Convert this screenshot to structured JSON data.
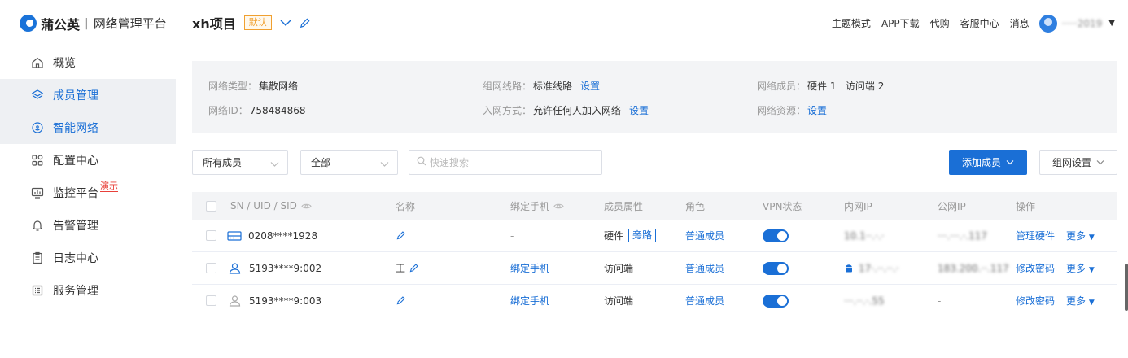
{
  "brand": {
    "name": "蒲公英",
    "subtitle": "网络管理平台"
  },
  "sidebar": {
    "items": [
      {
        "label": "概览",
        "icon": "home-icon"
      },
      {
        "label": "成员管理",
        "icon": "layers-icon",
        "active": true
      },
      {
        "label": "智能网络",
        "icon": "smart-network-icon",
        "active": true
      },
      {
        "label": "配置中心",
        "icon": "grid-icon"
      },
      {
        "label": "监控平台",
        "icon": "monitor-icon",
        "tag": "演示"
      },
      {
        "label": "告警管理",
        "icon": "bell-icon"
      },
      {
        "label": "日志中心",
        "icon": "log-icon"
      },
      {
        "label": "服务管理",
        "icon": "service-icon"
      }
    ]
  },
  "header": {
    "project_name": "xh项目",
    "default_badge": "默认",
    "links": [
      "主题模式",
      "APP下载",
      "代购",
      "客服中心",
      "消息"
    ],
    "username": "·····2019"
  },
  "network_info": {
    "type_label": "网络类型：",
    "type_value": "集散网络",
    "id_label": "网络ID：",
    "id_value": "758484868",
    "route_label": "组网线路：",
    "route_value": "标准线路",
    "route_link": "设置",
    "join_label": "入网方式：",
    "join_value": "允许任何人加入网络",
    "join_link": "设置",
    "members_label": "网络成员：",
    "members_value": "硬件 1   访问端 2",
    "resources_label": "网络资源：",
    "resources_link": "设置"
  },
  "filters": {
    "member_filter": "所有成员",
    "status_filter": "全部",
    "search_placeholder": "快速搜索",
    "add_member_button": "添加成员",
    "network_settings_button": "组网设置"
  },
  "table": {
    "headers": [
      "SN / UID / SID",
      "名称",
      "绑定手机",
      "成员属性",
      "角色",
      "VPN状态",
      "内网IP",
      "公网IP",
      "操作"
    ],
    "rows": [
      {
        "id": "0208****1928",
        "icon": "router-icon",
        "name": "",
        "phone": "-",
        "attribute": "硬件",
        "bypass_tag": "旁路",
        "role": "普通成员",
        "vpn": true,
        "lan_ip": "10.1··.·.·",
        "wan_ip": "···.···.·.117",
        "action": "管理硬件",
        "more": "更多"
      },
      {
        "id": "5193****9:002",
        "icon": "user-icon",
        "name": "王",
        "phone": "绑定手机",
        "attribute": "访问端",
        "bypass_tag": "",
        "role": "普通成员",
        "vpn": true,
        "lan_ip": "17·.··.··.·",
        "wan_ip": "183.200.··.117",
        "action": "修改密码",
        "more": "更多"
      },
      {
        "id": "5193****9:003",
        "icon": "user-outline-icon",
        "name": "",
        "phone": "绑定手机",
        "attribute": "访问端",
        "bypass_tag": "",
        "role": "普通成员",
        "vpn": true,
        "lan_ip": "···.··.·.55",
        "wan_ip": "-",
        "action": "修改密码",
        "more": "更多"
      }
    ]
  },
  "colors": {
    "accent": "#1a6fd6",
    "badge": "#f0a030",
    "demo_tag": "#e8403a"
  }
}
